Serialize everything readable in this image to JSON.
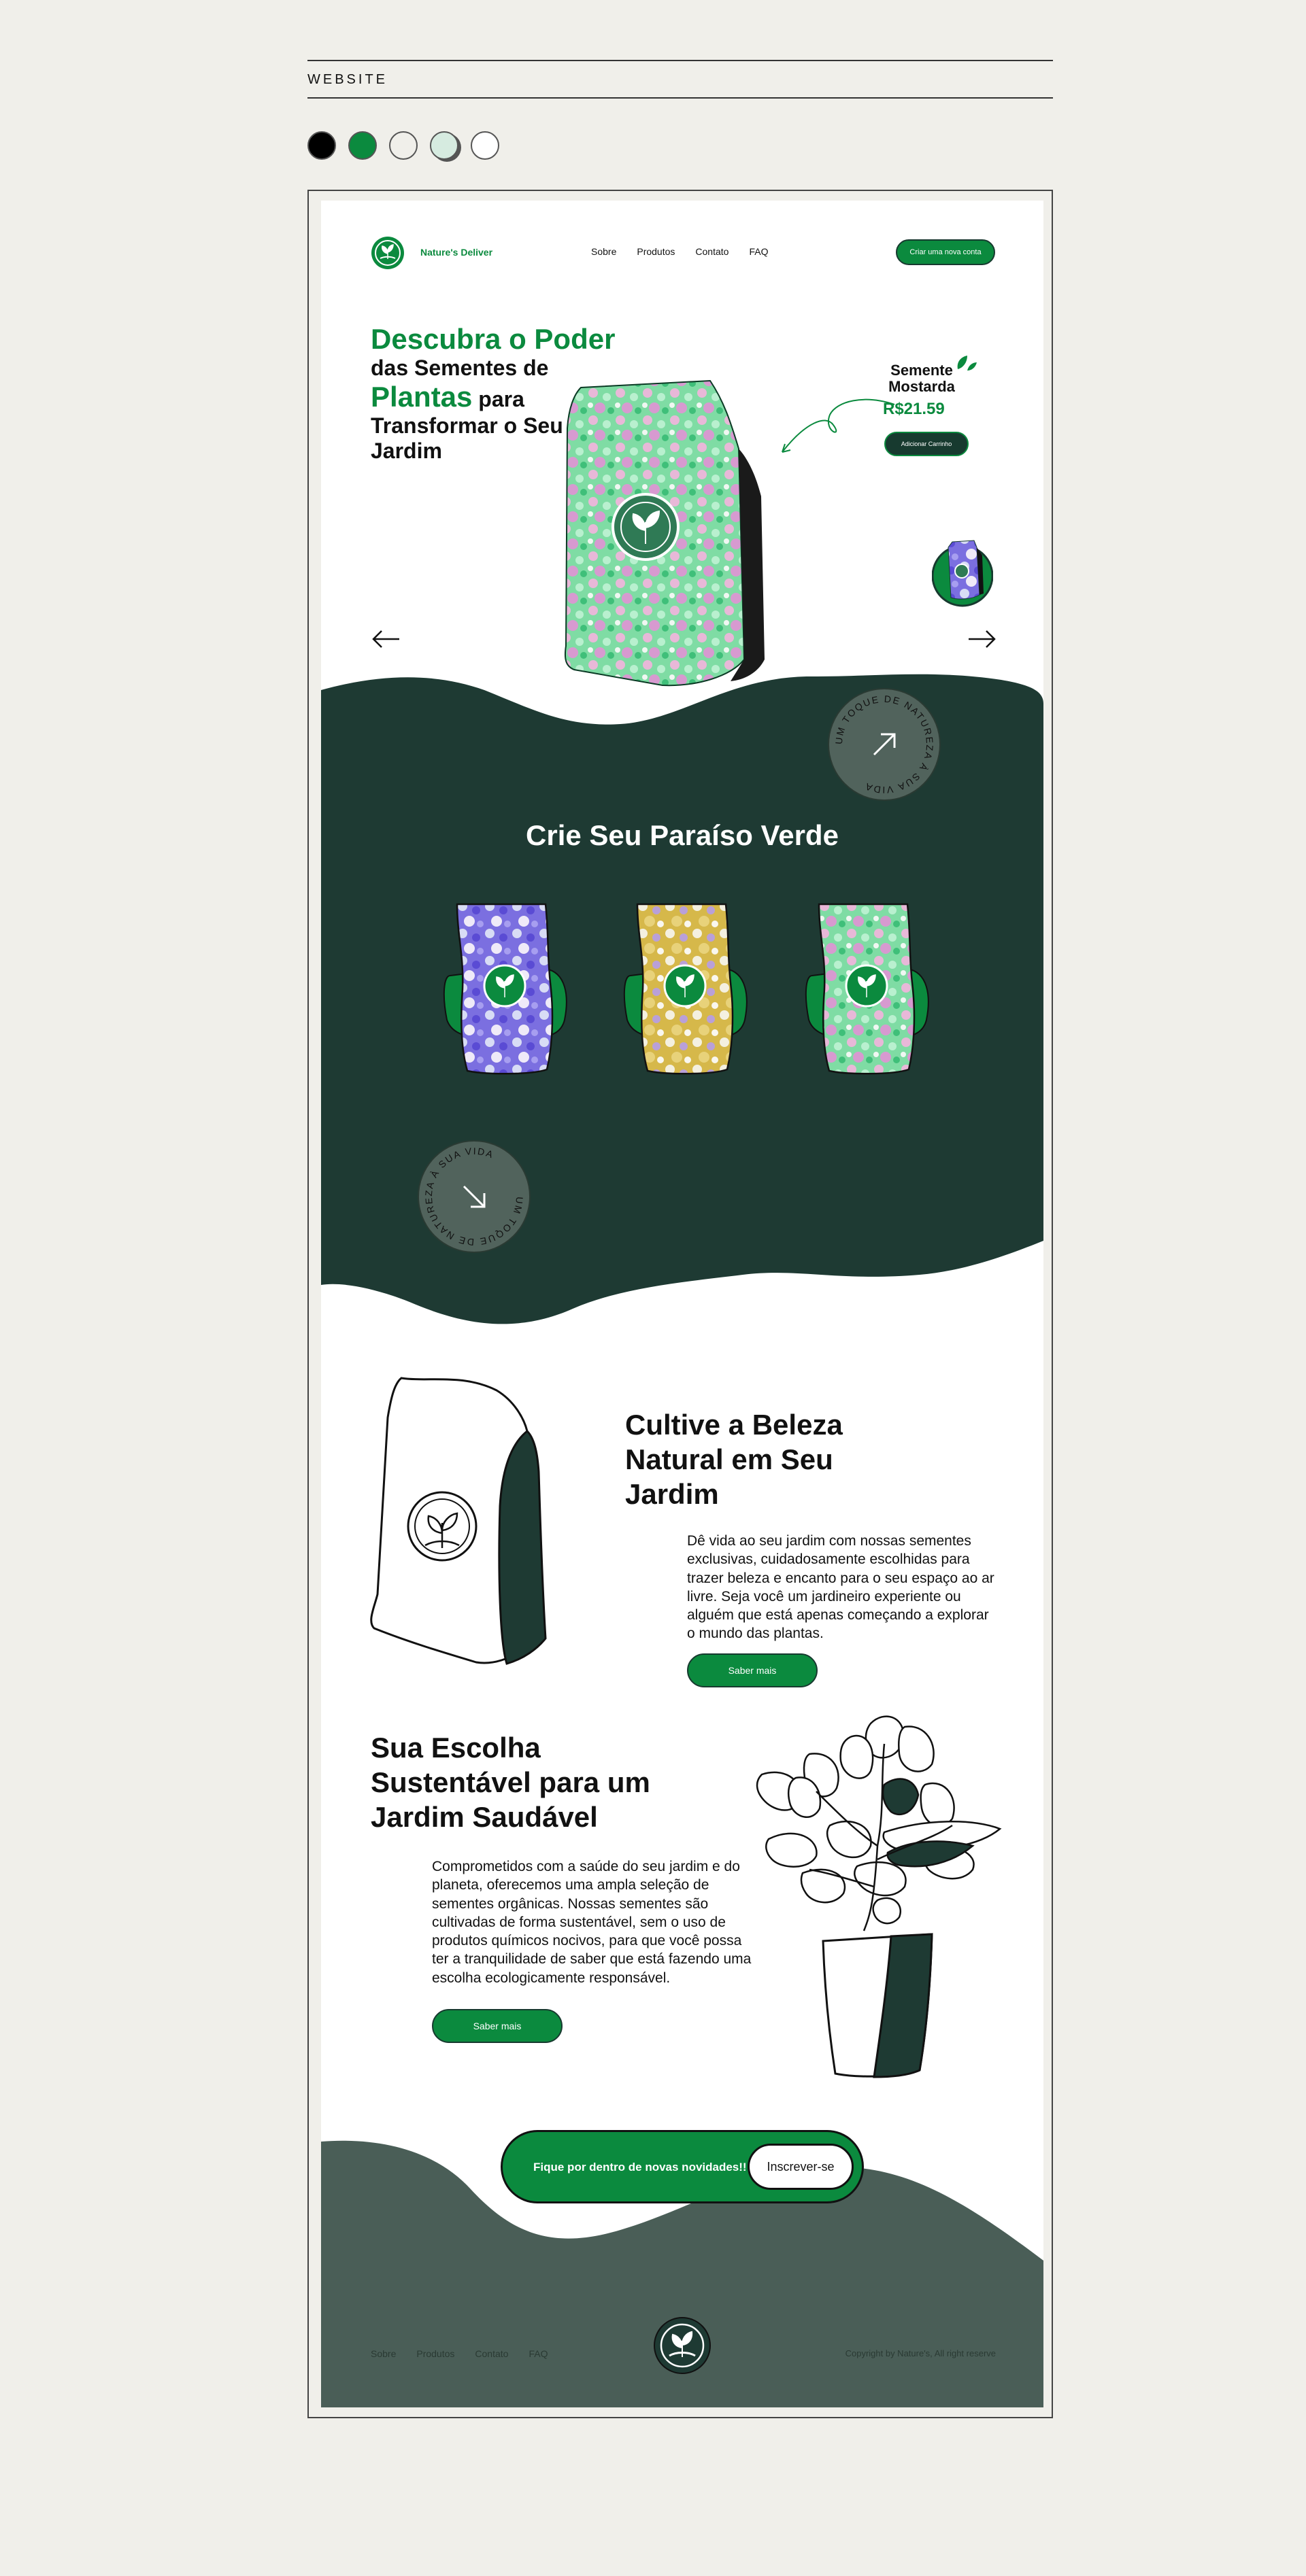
{
  "presentation": {
    "label": "WEBSITE",
    "palette": [
      "#000000",
      "#0b8a3e",
      "#f0efea",
      "#d6ebe0",
      "#ffffff"
    ]
  },
  "nav": {
    "brand": "Nature's Deliver",
    "links": [
      "Sobre",
      "Produtos",
      "Contato",
      "FAQ"
    ],
    "cta": "Criar uma nova conta"
  },
  "hero": {
    "title_line1": "Descubra o Poder",
    "title_line2": "das Sementes de",
    "title_line3_green": "Plantas",
    "title_line3_rest": " para",
    "title_line4": "Transformar o Seu",
    "title_line5": "Jardim",
    "product_name": "Semente Mostarda",
    "product_price": "R$21.59",
    "add_to_cart": "Adicionar Carrinho"
  },
  "badge": {
    "text": "UM TOQUE DE NATUREZA À SUA VIDA"
  },
  "products_section": {
    "title": "Crie Seu Paraíso Verde"
  },
  "cultivate": {
    "title": "Cultive a Beleza Natural em Seu Jardim",
    "text": "Dê vida ao seu jardim com nossas sementes exclusivas, cuidadosamente escolhidas para trazer beleza e encanto para o seu espaço ao ar livre. Seja você um jardineiro experiente ou alguém que está apenas começando a explorar o mundo das plantas.",
    "button": "Saber mais"
  },
  "sustainable": {
    "title": "Sua Escolha Sustentável para um Jardim Saudável",
    "text": "Comprometidos com a saúde do seu jardim e do planeta, oferecemos uma ampla seleção de sementes orgânicas. Nossas sementes são cultivadas de forma sustentável, sem o uso de produtos químicos nocivos, para que você possa ter a tranquilidade de saber que está fazendo uma escolha ecologicamente responsável.",
    "button": "Saber mais"
  },
  "newsletter": {
    "text": "Fique por dentro de novas novidades!!",
    "button": "Inscrever-se"
  },
  "footer": {
    "links": [
      "Sobre",
      "Produtos",
      "Contato",
      "FAQ"
    ],
    "copyright": "Copyright by Nature's, All right reserve"
  }
}
